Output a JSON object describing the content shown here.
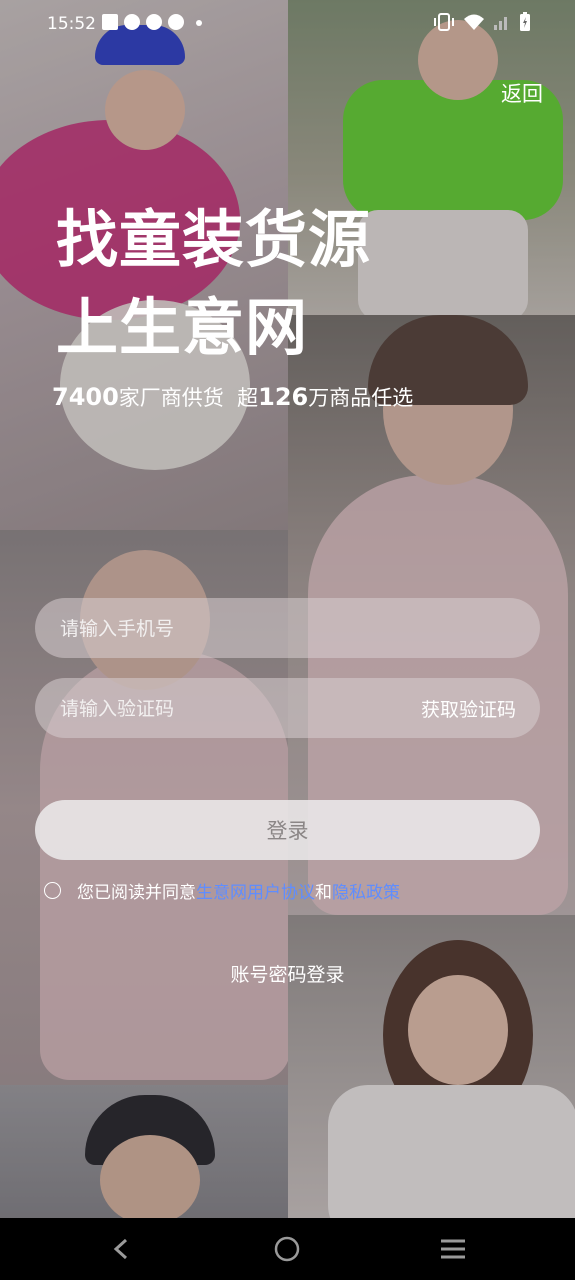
{
  "status_bar": {
    "time": "15:52",
    "icons": [
      "mail-icon",
      "app-icon",
      "app-icon",
      "app-icon",
      "dot-icon",
      "vibrate-icon",
      "wifi-icon",
      "signal-icon",
      "battery-icon"
    ]
  },
  "header": {
    "back_label": "返回"
  },
  "hero": {
    "line1": "找童装货源",
    "line2": "上生意网",
    "stat1_number": "7400",
    "stat1_text": "家厂商供货",
    "stat2_prefix": "超",
    "stat2_number": "126",
    "stat2_text": "万商品任选"
  },
  "form": {
    "phone_placeholder": "请输入手机号",
    "code_placeholder": "请输入验证码",
    "get_code_label": "获取验证码",
    "login_label": "登录",
    "agree_prefix": "您已阅读并同意",
    "agreement_link": "生意网用户协议",
    "and_text": "和",
    "privacy_link": "隐私政策",
    "password_login_label": "账号密码登录"
  },
  "colors": {
    "link": "#5f8dff",
    "field_bg": "rgba(215,205,207,0.55)"
  },
  "nav": [
    "back-icon",
    "home-icon",
    "menu-icon"
  ]
}
